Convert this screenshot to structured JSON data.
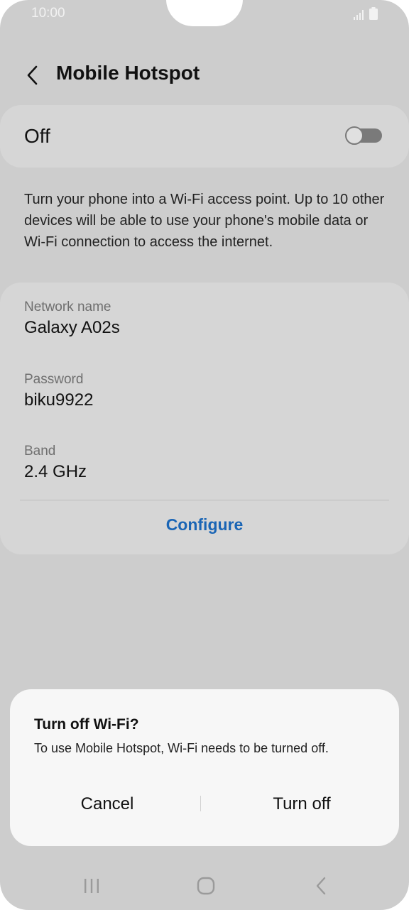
{
  "status_bar": {
    "time": "10:00",
    "icons": [
      "signal-icon",
      "battery-icon"
    ]
  },
  "header": {
    "back_icon": "chevron-left-icon",
    "title": "Mobile Hotspot"
  },
  "hotspot_toggle": {
    "label": "Off",
    "state": "off"
  },
  "description": "Turn your phone into a Wi-Fi access point. Up to 10 other devices will be able to use your phone's mobile data or Wi-Fi connection to access the internet.",
  "network": {
    "fields": [
      {
        "label": "Network name",
        "value": "Galaxy A02s"
      },
      {
        "label": "Password",
        "value": "biku9922"
      },
      {
        "label": "Band",
        "value": "2.4 GHz"
      }
    ],
    "configure_label": "Configure"
  },
  "dialog": {
    "title": "Turn off Wi-Fi?",
    "message": "To use Mobile Hotspot, Wi-Fi needs to be turned off.",
    "cancel_label": "Cancel",
    "confirm_label": "Turn off"
  },
  "nav_bar": {
    "icons": [
      "recent-apps-icon",
      "home-icon",
      "back-icon"
    ]
  },
  "colors": {
    "accent": "#1a65b5",
    "screen_dim": "#cdcdcd",
    "dialog_bg": "#f7f7f7"
  }
}
